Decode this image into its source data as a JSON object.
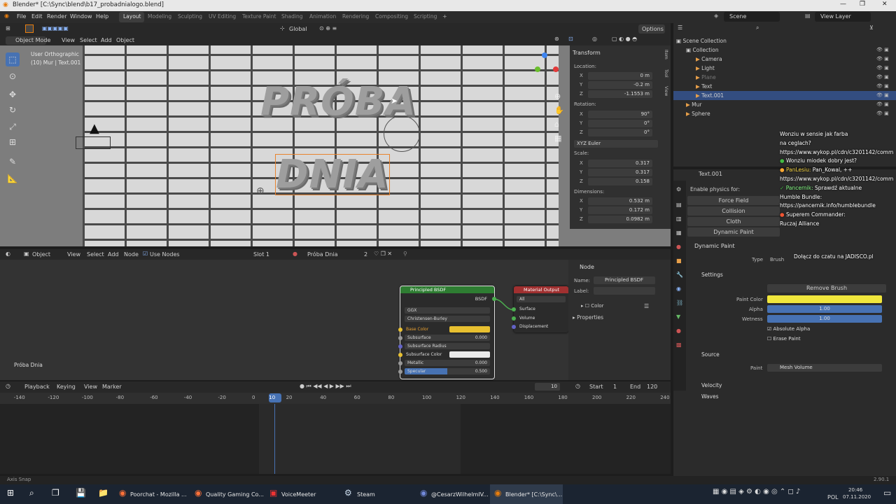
{
  "window_title": "Blender* [C:\\Sync\\blend\\b17_probadnialogo.blend]",
  "menus": [
    "File",
    "Edit",
    "Render",
    "Window",
    "Help"
  ],
  "workspaces": [
    "Layout",
    "Modeling",
    "Sculpting",
    "UV Editing",
    "Texture Paint",
    "Shading",
    "Animation",
    "Rendering",
    "Compositing",
    "Scripting"
  ],
  "active_workspace": "Layout",
  "scene_name": "Scene",
  "view_layer": "View Layer",
  "viewport": {
    "transform_orientation": "Global",
    "options_label": "Options",
    "mode": "Object Mode",
    "menus": [
      "View",
      "Select",
      "Add",
      "Object"
    ],
    "view_name": "User Orthographic",
    "context": "(10) Mur | Text.001",
    "text_line1": "PRÓBA",
    "text_line2": "DNIA"
  },
  "transform_panel": {
    "title": "Transform",
    "location_label": "Location:",
    "location": {
      "x": "0 m",
      "y": "-0.2 m",
      "z": "-1.1553 m"
    },
    "rotation_label": "Rotation:",
    "rotation": {
      "x": "90°",
      "y": "0°",
      "z": "0°"
    },
    "rotation_mode": "XYZ Euler",
    "scale_label": "Scale:",
    "scale": {
      "x": "0.317",
      "y": "0.317",
      "z": "0.158"
    },
    "dimensions_label": "Dimensions:",
    "dimensions": {
      "x": "0.532 m",
      "y": "0.172 m",
      "z": "0.0982 m"
    },
    "tabs": [
      "Item",
      "Tool",
      "View"
    ]
  },
  "outliner": {
    "root": "Scene Collection",
    "items": [
      {
        "label": "Collection",
        "indent": 1
      },
      {
        "label": "Camera",
        "indent": 2
      },
      {
        "label": "Light",
        "indent": 2
      },
      {
        "label": "Plane",
        "indent": 2
      },
      {
        "label": "Text",
        "indent": 2
      },
      {
        "label": "Text.001",
        "indent": 2
      },
      {
        "label": "Mur",
        "indent": 1
      },
      {
        "label": "Sphere",
        "indent": 1
      }
    ]
  },
  "properties": {
    "object_name": "Text.001",
    "physics_header": "Enable physics for:",
    "physics": [
      "Force Field",
      "Collision",
      "Cloth",
      "Dynamic Paint"
    ],
    "dynamic_paint_title": "Dynamic Paint",
    "type_label": "Type",
    "type_value": "Brush",
    "settings_title": "Settings",
    "remove_brush": "Remove Brush",
    "paint_color_label": "Paint Color",
    "alpha_label": "Alpha",
    "alpha_value": "1.00",
    "wetness_label": "Wetness",
    "wetness_value": "1.00",
    "absolute_alpha": "Absolute Alpha",
    "erase_paint": "Erase Paint",
    "source_title": "Source",
    "paint_label": "Paint",
    "paint_value": "Mesh Volume",
    "velocity": "Velocity",
    "waves": "Waves"
  },
  "chat": [
    {
      "user": "",
      "text": "Wonziu w sensie jak farba"
    },
    {
      "user": "",
      "text": "na ceglach?"
    },
    {
      "user": "",
      "text": "https://www.wykop.pl/cdn/c3201142/comm"
    },
    {
      "user": "",
      "text": "Wonziu miodek dobry jest?"
    },
    {
      "user": "PanLesiu:",
      "text": "Pan_Kowal, ++"
    },
    {
      "user": "",
      "text": "https://www.wykop.pl/cdn/c3201142/comm"
    },
    {
      "user": "Pancernik:",
      "text": "Sprawdź aktualne"
    },
    {
      "user": "",
      "text": "Humble Bundle:"
    },
    {
      "user": "",
      "text": "https://pancernik.info/humblebundle"
    },
    {
      "user": "",
      "text": "Superem Commander:"
    },
    {
      "user": "",
      "text": "Ruczaj Alliance"
    }
  ],
  "chat_join": "Dołącz do czatu na JADISCO.pl",
  "node_editor": {
    "mode": "Object",
    "menus": [
      "View",
      "Select",
      "Add",
      "Node"
    ],
    "use_nodes": "Use Nodes",
    "slot": "Slot 1",
    "material": "Próba Dnia",
    "users": "2",
    "material_label": "Próba Dnia",
    "principled": {
      "title": "Principled BSDF",
      "output": "BSDF",
      "distribution": "GGX",
      "subsurface_method": "Christensen-Burley",
      "base_color": "Base Color",
      "subsurface": "Subsurface",
      "subsurface_value": "0.000",
      "subsurface_radius": "Subsurface Radius",
      "subsurface_color": "Subsurface Color",
      "metallic": "Metallic",
      "metallic_value": "0.000",
      "specular": "Specular",
      "specular_value": "0.500"
    },
    "output_node": {
      "title": "Material Output",
      "target": "All",
      "inputs": [
        "Surface",
        "Volume",
        "Displacement"
      ]
    },
    "sidebar": {
      "title": "Node",
      "name_label": "Name:",
      "name_value": "Principled BSDF",
      "label_label": "Label:",
      "color": "Color",
      "properties": "Properties"
    }
  },
  "timeline": {
    "menus": [
      "Playback",
      "Keying",
      "View",
      "Marker"
    ],
    "current_frame": "10",
    "start_label": "Start",
    "start": "1",
    "end_label": "End",
    "end": "120",
    "ticks": [
      "-140",
      "-120",
      "-100",
      "-80",
      "-60",
      "-40",
      "-20",
      "0",
      "10",
      "20",
      "40",
      "60",
      "80",
      "100",
      "120",
      "140",
      "160",
      "180",
      "200",
      "220",
      "240"
    ]
  },
  "status_bar": {
    "left": "Axis Snap",
    "version": "2.90.1"
  },
  "taskbar": {
    "items": [
      "Poorchat - Mozilla ...",
      "Quality Gaming Co...",
      "VoiceMeeter",
      "Steam",
      "@CesarzWilhelmIV...",
      "Blender* [C:\\Sync\\..."
    ],
    "language": "POL",
    "time": "20:46",
    "date": "07.11.2020"
  },
  "colors": {
    "accent": "#4772b3",
    "paint_color": "#f0e63c",
    "base_color": "#e8c030",
    "node_header_green": "#2e7d32",
    "node_header_red": "#a03030"
  }
}
